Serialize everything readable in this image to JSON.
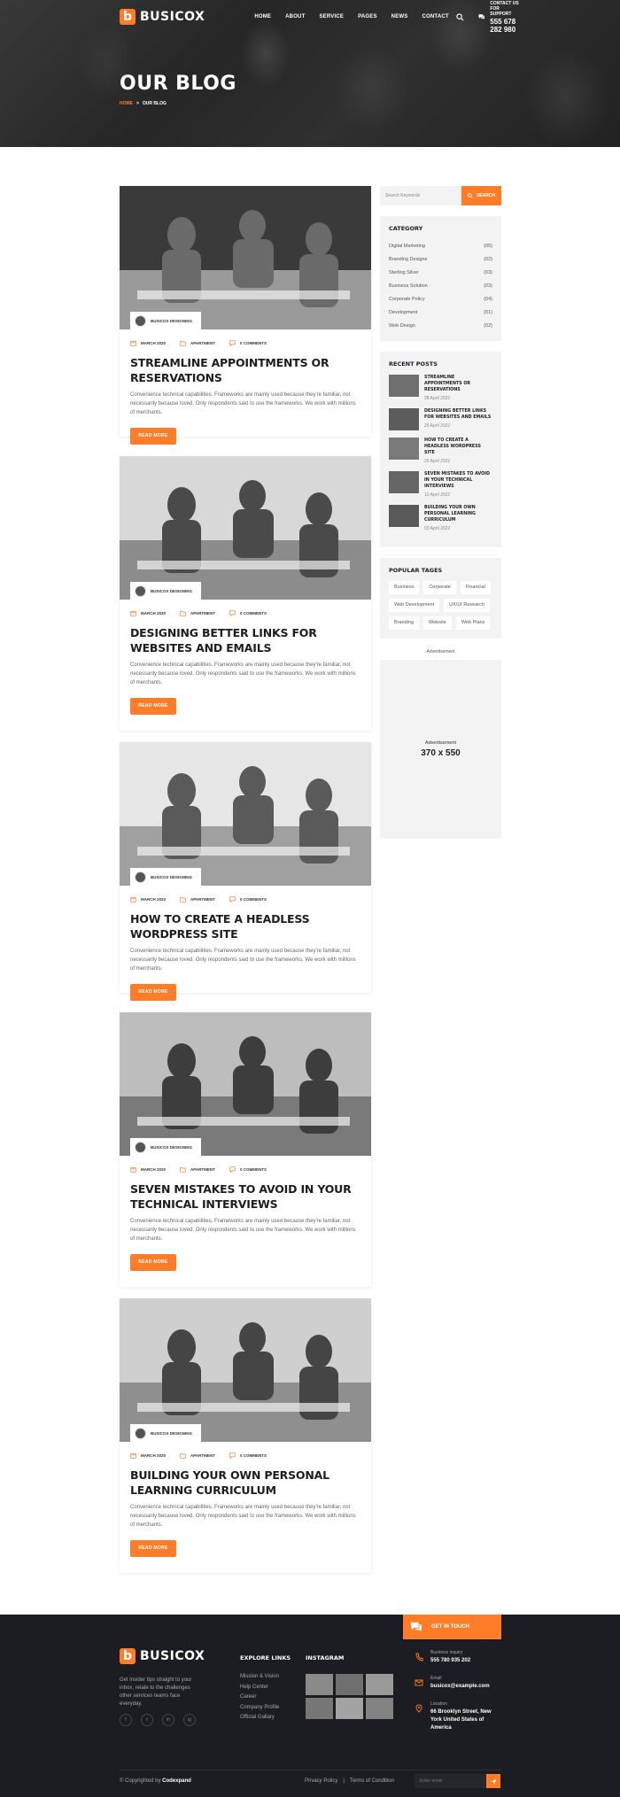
{
  "brand": {
    "name": "BUSICOX",
    "logo_letter": "b"
  },
  "nav": [
    "HOME",
    "ABOUT",
    "SERVICE",
    "PAGES",
    "NEWS",
    "CONTACT"
  ],
  "support": {
    "label": "CONTACT US FOR SUPPORT",
    "phone": "555 678 282 980"
  },
  "hero": {
    "title": "OUR BLOG",
    "breadcrumb_home": "HOME",
    "breadcrumb_sep": ">",
    "breadcrumb_current": "OUR BLOG"
  },
  "posts": [
    {
      "author": "BUSICOX DESIGNING",
      "date": "MARCH 2020",
      "category": "APARTMENT",
      "comments": "0 COMMENTS",
      "title": "STREAMLINE APPOINTMENTS OR RESERVATIONS",
      "excerpt": "Convenience technical capabilities. Frameworks are mainly used because they're familiar, not necessarily because loved. Only respondents said to use the frameworks. We work with millions of merchants.",
      "button": "READ MORE"
    },
    {
      "author": "BUSICOX DESIGNING",
      "date": "MARCH 2020",
      "category": "APARTMENT",
      "comments": "0 COMMENTS",
      "title": "DESIGNING BETTER LINKS FOR WEBSITES AND EMAILS",
      "excerpt": "Convenience technical capabilities. Frameworks are mainly used because they're familiar, not necessarily because loved. Only respondents said to use the frameworks. We work with millions of merchants.",
      "button": "READ MORE"
    },
    {
      "author": "BUSICOX DESIGNING",
      "date": "MARCH 2020",
      "category": "APARTMENT",
      "comments": "0 COMMENTS",
      "title": "HOW TO CREATE A HEADLESS WORDPRESS SITE",
      "excerpt": "Convenience technical capabilities. Frameworks are mainly used because they're familiar, not necessarily because loved. Only respondents said to use the frameworks. We work with millions of merchants.",
      "button": "READ MORE"
    },
    {
      "author": "BUSICOX DESIGNING",
      "date": "MARCH 2020",
      "category": "APARTMENT",
      "comments": "0 COMMENTS",
      "title": "SEVEN MISTAKES TO AVOID IN YOUR TECHNICAL INTERVIEWS",
      "excerpt": "Convenience technical capabilities. Frameworks are mainly used because they're familiar, not necessarily because loved. Only respondents said to use the frameworks. We work with millions of merchants.",
      "button": "READ MORE"
    },
    {
      "author": "BUSICOX DESIGNING",
      "date": "MARCH 2020",
      "category": "APARTMENT",
      "comments": "0 COMMENTS",
      "title": "BUILDING YOUR OWN PERSONAL LEARNING CURRICULUM",
      "excerpt": "Convenience technical capabilities. Frameworks are mainly used because they're familiar, not necessarily because loved. Only respondents said to use the frameworks. We work with millions of merchants.",
      "button": "READ MORE"
    }
  ],
  "sidebar": {
    "search_placeholder": "Search Keywords",
    "search_button": "SEARCH",
    "category_title": "CATEGORY",
    "categories": [
      {
        "name": "Digital Marketing",
        "count": "(05)"
      },
      {
        "name": "Branding Designs",
        "count": "(02)"
      },
      {
        "name": "Sterling Silver",
        "count": "(03)"
      },
      {
        "name": "Business Solution",
        "count": "(03)"
      },
      {
        "name": "Corporate Policy",
        "count": "(04)"
      },
      {
        "name": "Development",
        "count": "(01)"
      },
      {
        "name": "Web Design",
        "count": "(02)"
      }
    ],
    "recent_title": "RECENT POSTS",
    "recent": [
      {
        "title": "STREAMLINE APPOINTMENTS OR RESERVATIONS",
        "date": "28 April 2022"
      },
      {
        "title": "DESIGNING BETTER LINKS FOR WEBSITES AND EMAILS",
        "date": "25 April 2022"
      },
      {
        "title": "HOW TO CREATE A HEADLESS WORDPRESS SITE",
        "date": "20 April 2022"
      },
      {
        "title": "SEVEN MISTAKES TO AVOID IN YOUR TECHNICAL INTERVIEWS",
        "date": "10 April 2022"
      },
      {
        "title": "BUILDING YOUR OWN PERSONAL LEARNING CURRICULUM",
        "date": "03 April 2022"
      }
    ],
    "tags_title": "POPULAR TAGES",
    "tags": [
      "Business",
      "Corporate",
      "Financial",
      "Web Development",
      "UX/UI Research",
      "Branding",
      "Website",
      "Web Plans"
    ],
    "ad_label": "Advertisement",
    "ad_box_label": "Advertisement",
    "ad_box_size": "370 x 550"
  },
  "footer": {
    "touch": "GET IN TOUCH",
    "about": "Get insider tips straight to your inbox, relate to the challenges other services teams face everyday.",
    "social": [
      "f",
      "t",
      "in",
      "ig"
    ],
    "links_title": "EXPLORE LINKS",
    "links": [
      "Mission & Vision",
      "Help Center",
      "Career",
      "Company Profile",
      "Official Gallary"
    ],
    "insta_title": "INSTAGRAM",
    "contact": [
      {
        "label": "Business inquiry",
        "value": "555 780 935 202"
      },
      {
        "label": "Email",
        "value": "busicox@example.com"
      },
      {
        "label": "Location",
        "value": "66 Brooklyn Street, New York United States of America"
      }
    ],
    "copyright_prefix": "© Copyrighted by",
    "copyright_brand": "Codexpand",
    "privacy": "Privacy Policy",
    "sep": "|",
    "terms": "Terms of Condition",
    "newsletter_placeholder": "Enter email"
  },
  "colors": {
    "accent": "#ff7d29",
    "dark": "#1c1d22",
    "widget_bg": "#f3f3f3"
  }
}
